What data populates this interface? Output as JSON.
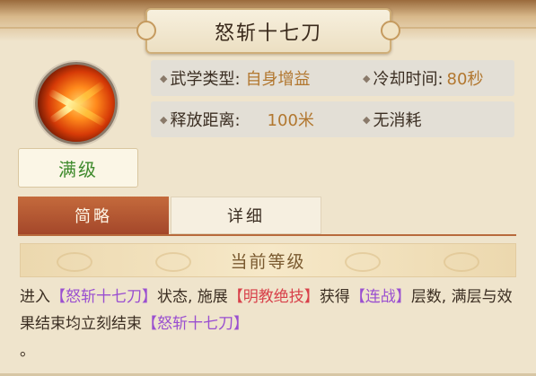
{
  "skill": {
    "name": "怒斩十七刀",
    "icon": "flame-slash-icon",
    "level": "满级"
  },
  "info": {
    "type_label": "武学类型:",
    "type_value": "自身增益",
    "cooldown_label": "冷却时间:",
    "cooldown_value": "80秒",
    "range_label": "释放距离:",
    "range_value": "100米",
    "cost": "无消耗"
  },
  "tabs": [
    {
      "label": "简略",
      "active": true
    },
    {
      "label": "详细",
      "active": false
    }
  ],
  "section_title": "当前等级",
  "description": {
    "p1": "进入",
    "h1": "【怒斩十七刀】",
    "p2": "状态, 施展",
    "h2": "【明教绝技】",
    "p3": "获得",
    "h3": "【连战】",
    "p4": "层数, 满层与效果结束均立刻结束",
    "h4": "【怒斩十七刀】",
    "p5": "。"
  },
  "colors": {
    "highlight_purple": "#9a4fd0",
    "highlight_red": "#d8404a",
    "value_gold": "#b2772f",
    "level_green": "#3e8a2c",
    "tab_active": "#b4552f"
  }
}
